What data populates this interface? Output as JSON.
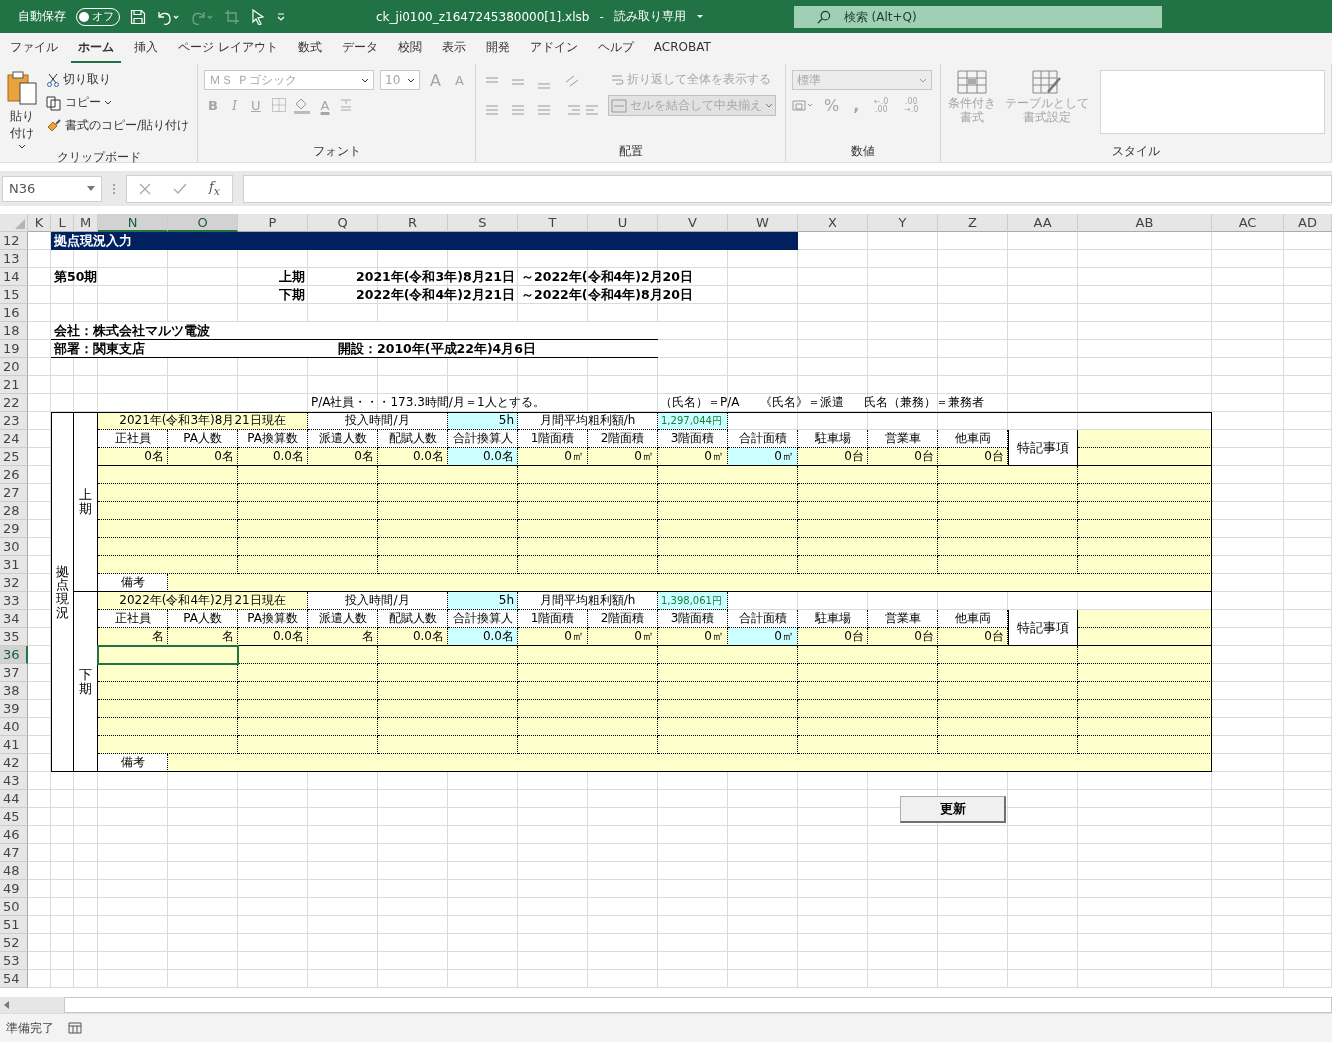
{
  "title_bar": {
    "autosave_label": "自動保存",
    "autosave_toggle": {
      "label": "オフ",
      "on": false
    },
    "filename": "ck_ji0100_z1647245380000[1].xlsb",
    "separator": "-",
    "mode": "読み取り専用",
    "search_placeholder": "検索 (Alt+Q)"
  },
  "ribbon_tabs": [
    {
      "label": "ファイル",
      "selected": false
    },
    {
      "label": "ホーム",
      "selected": true
    },
    {
      "label": "挿入",
      "selected": false
    },
    {
      "label": "ページ レイアウト",
      "selected": false
    },
    {
      "label": "数式",
      "selected": false
    },
    {
      "label": "データ",
      "selected": false
    },
    {
      "label": "校閲",
      "selected": false
    },
    {
      "label": "表示",
      "selected": false
    },
    {
      "label": "開発",
      "selected": false
    },
    {
      "label": "アドイン",
      "selected": false
    },
    {
      "label": "ヘルプ",
      "selected": false
    },
    {
      "label": "ACROBAT",
      "selected": false
    }
  ],
  "ribbon": {
    "clipboard": {
      "paste": "貼り付け",
      "cut": "切り取り",
      "copy": "コピー",
      "format_painter": "書式のコピー/貼り付け",
      "label": "クリップボード",
      "disabled": false
    },
    "font": {
      "name": "ＭＳ Ｐゴシック",
      "size": "10",
      "grow": "A",
      "shrink": "A",
      "bold": "B",
      "italic": "I",
      "underline": "U",
      "font_color": "A",
      "label": "フォント",
      "disabled": true
    },
    "alignment": {
      "wrap": "折り返して全体を表示する",
      "merge": "セルを結合して中央揃え",
      "label": "配置",
      "disabled": true
    },
    "number": {
      "format": "標準",
      "percent": "%",
      "comma": ",",
      "decimal_increase": "←.0 .00",
      "decimal_decrease": ".00 →.0",
      "label": "数値",
      "disabled": true
    },
    "styles": {
      "conditional": "条件付き書式",
      "table": "テーブルとして書式設定",
      "label": "スタイル",
      "disabled": true
    }
  },
  "formula_bar": {
    "name_box": "N36",
    "fx": "f$_{x}$"
  },
  "sheet": {
    "columns": [
      {
        "label": "K",
        "selected": false
      },
      {
        "label": "L",
        "selected": false
      },
      {
        "label": "M",
        "selected": false
      },
      {
        "label": "N",
        "selected": true
      },
      {
        "label": "O",
        "selected": true
      },
      {
        "label": "P",
        "selected": false
      },
      {
        "label": "Q",
        "selected": false
      },
      {
        "label": "R",
        "selected": false
      },
      {
        "label": "S",
        "selected": false
      },
      {
        "label": "T",
        "selected": false
      },
      {
        "label": "U",
        "selected": false
      },
      {
        "label": "V",
        "selected": false
      },
      {
        "label": "W",
        "selected": false
      },
      {
        "label": "X",
        "selected": false
      },
      {
        "label": "Y",
        "selected": false
      },
      {
        "label": "Z",
        "selected": false
      },
      {
        "label": "AA",
        "selected": false
      },
      {
        "label": "AB",
        "selected": false
      },
      {
        "label": "AC",
        "selected": false
      },
      {
        "label": "AD",
        "selected": false
      }
    ],
    "rows": [
      {
        "label": "12",
        "selected": false
      },
      {
        "label": "13",
        "selected": false
      },
      {
        "label": "14",
        "selected": false
      },
      {
        "label": "15",
        "selected": false
      },
      {
        "label": "16",
        "selected": false
      },
      {
        "label": "18",
        "selected": false
      },
      {
        "label": "19",
        "selected": false
      },
      {
        "label": "20",
        "selected": false
      },
      {
        "label": "21",
        "selected": false
      },
      {
        "label": "22",
        "selected": false
      },
      {
        "label": "23",
        "selected": false
      },
      {
        "label": "24",
        "selected": false
      },
      {
        "label": "25",
        "selected": false
      },
      {
        "label": "26",
        "selected": false
      },
      {
        "label": "27",
        "selected": false
      },
      {
        "label": "28",
        "selected": false
      },
      {
        "label": "29",
        "selected": false
      },
      {
        "label": "30",
        "selected": false
      },
      {
        "label": "31",
        "selected": false
      },
      {
        "label": "32",
        "selected": false
      },
      {
        "label": "33",
        "selected": false
      },
      {
        "label": "34",
        "selected": false
      },
      {
        "label": "35",
        "selected": false
      },
      {
        "label": "36",
        "selected": true
      },
      {
        "label": "37",
        "selected": false
      },
      {
        "label": "38",
        "selected": false
      },
      {
        "label": "39",
        "selected": false
      },
      {
        "label": "40",
        "selected": false
      },
      {
        "label": "41",
        "selected": false
      },
      {
        "label": "42",
        "selected": false
      },
      {
        "label": "43",
        "selected": false
      },
      {
        "label": "44",
        "selected": false
      },
      {
        "label": "45",
        "selected": false
      },
      {
        "label": "46",
        "selected": false
      },
      {
        "label": "47",
        "selected": false
      },
      {
        "label": "48",
        "selected": false
      },
      {
        "label": "49",
        "selected": false
      },
      {
        "label": "50",
        "selected": false
      },
      {
        "label": "51",
        "selected": false
      },
      {
        "label": "52",
        "selected": false
      },
      {
        "label": "53",
        "selected": false
      },
      {
        "label": "54",
        "selected": false
      }
    ],
    "banner": "拠点現況入力",
    "term": "第50期",
    "halves": [
      {
        "label": "上期",
        "from": "2021年(令和3年)8月21日",
        "to": "～2022年(令和4年)2月20日"
      },
      {
        "label": "下期",
        "from": "2022年(令和4年)2月21日",
        "to": "～2022年(令和4年)8月20日"
      }
    ],
    "company": "会社：株式会社マルツ電波",
    "department": "部署：関東支店",
    "opened": "開設：2010年(平成22年)4月6日",
    "note": "P/A社員・・・173.3時間/月＝1人とする。",
    "legend": [
      "（氏名）＝P/A",
      "《氏名》＝派遣",
      "氏名（兼務）＝兼務者"
    ],
    "side_label": "拠点現況",
    "blocks": [
      {
        "period": "上期",
        "as_of": "2021年(令和3年)8月21日現在",
        "hours_label": "投入時間/月",
        "hours": "5h",
        "profit_label": "月間平均粗利額/h",
        "profit": "1,297,044円",
        "special_label": "特記事項",
        "remarks_label": "備考",
        "headers": [
          "正社員",
          "PA人数",
          "PA換算数",
          "派遣人数",
          "配賦人数",
          "合計換算人",
          "1階面積",
          "2階面積",
          "3階面積",
          "合計面積",
          "駐車場",
          "営業車",
          "他車両"
        ],
        "values": [
          {
            "text": "0名",
            "kind": "input"
          },
          {
            "text": "0名",
            "kind": "input"
          },
          {
            "text": "0.0名",
            "kind": "input"
          },
          {
            "text": "0名",
            "kind": "input"
          },
          {
            "text": "0.0名",
            "kind": "input"
          },
          {
            "text": "0.0名",
            "kind": "total"
          },
          {
            "text": "0㎡",
            "kind": "input"
          },
          {
            "text": "0㎡",
            "kind": "input"
          },
          {
            "text": "0㎡",
            "kind": "input"
          },
          {
            "text": "0㎡",
            "kind": "total"
          },
          {
            "text": "0台",
            "kind": "input"
          },
          {
            "text": "0台",
            "kind": "input"
          },
          {
            "text": "0台",
            "kind": "input"
          }
        ],
        "detail_rows": [
          {
            "selected": false
          },
          {
            "selected": false
          },
          {
            "selected": false
          },
          {
            "selected": false
          },
          {
            "selected": false
          },
          {
            "selected": false
          }
        ]
      },
      {
        "period": "下期",
        "as_of": "2022年(令和4年)2月21日現在",
        "hours_label": "投入時間/月",
        "hours": "5h",
        "profit_label": "月間平均粗利額/h",
        "profit": "1,398,061円",
        "special_label": "特記事項",
        "remarks_label": "備考",
        "headers": [
          "正社員",
          "PA人数",
          "PA換算数",
          "派遣人数",
          "配賦人数",
          "合計換算人",
          "1階面積",
          "2階面積",
          "3階面積",
          "合計面積",
          "駐車場",
          "営業車",
          "他車両"
        ],
        "values": [
          {
            "text": "名",
            "kind": "input"
          },
          {
            "text": "名",
            "kind": "input"
          },
          {
            "text": "0.0名",
            "kind": "input"
          },
          {
            "text": "名",
            "kind": "input"
          },
          {
            "text": "0.0名",
            "kind": "input"
          },
          {
            "text": "0.0名",
            "kind": "total"
          },
          {
            "text": "0㎡",
            "kind": "input"
          },
          {
            "text": "0㎡",
            "kind": "input"
          },
          {
            "text": "0㎡",
            "kind": "input"
          },
          {
            "text": "0㎡",
            "kind": "total"
          },
          {
            "text": "0台",
            "kind": "input"
          },
          {
            "text": "0台",
            "kind": "input"
          },
          {
            "text": "0台",
            "kind": "input"
          }
        ],
        "detail_rows": [
          {
            "selected": true
          },
          {
            "selected": false
          },
          {
            "selected": false
          },
          {
            "selected": false
          },
          {
            "selected": false
          },
          {
            "selected": false
          }
        ]
      }
    ],
    "update_button": "更新"
  },
  "status_bar": {
    "text": "準備完了"
  }
}
